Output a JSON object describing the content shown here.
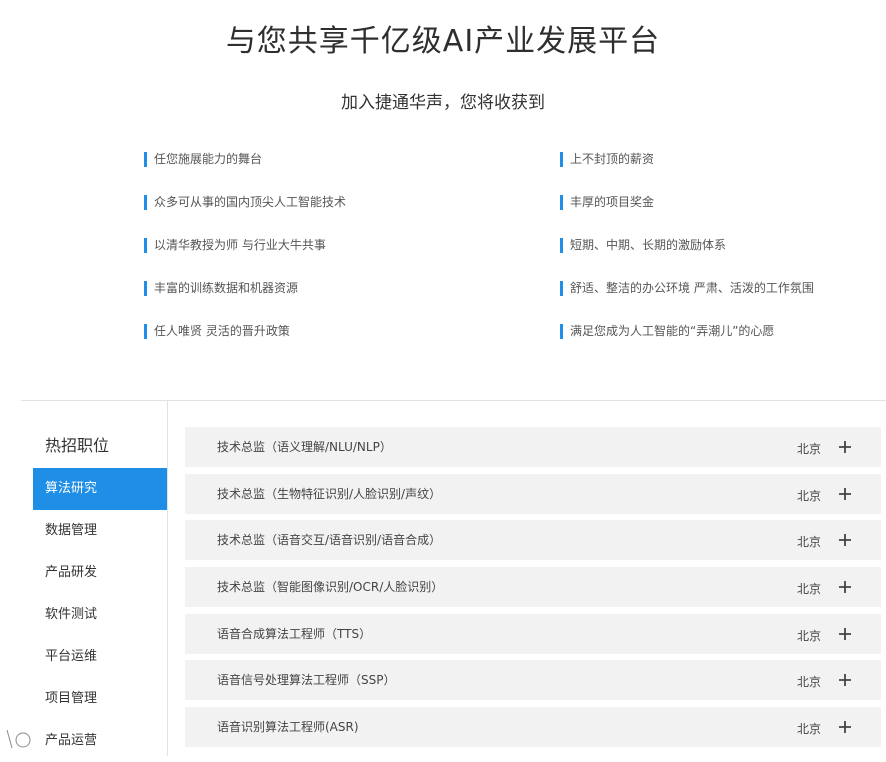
{
  "hero": {
    "title": "与您共享千亿级AI产业发展平台",
    "subtitle": "加入捷通华声，您将收获到"
  },
  "benefits": {
    "left": [
      "任您施展能力的舞台",
      "众多可从事的国内顶尖人工智能技术",
      "以清华教授为师  与行业大牛共事",
      "丰富的训练数据和机器资源",
      "任人唯贤  灵活的晋升政策"
    ],
    "right": [
      "上不封顶的薪资",
      "丰厚的项目奖金",
      "短期、中期、长期的激励体系",
      "舒适、整洁的办公环境  严肃、活泼的工作氛围",
      "满足您成为人工智能的“弄潮儿”的心愿"
    ]
  },
  "sidebar": {
    "heading": "热招职位",
    "items": [
      {
        "label": "算法研究",
        "active": true
      },
      {
        "label": "数据管理",
        "active": false
      },
      {
        "label": "产品研发",
        "active": false
      },
      {
        "label": "软件测试",
        "active": false
      },
      {
        "label": "平台运维",
        "active": false
      },
      {
        "label": "项目管理",
        "active": false
      },
      {
        "label": "产品运营",
        "active": false
      }
    ]
  },
  "jobs": [
    {
      "title": "技术总监（语义理解/NLU/NLP）",
      "city": "北京"
    },
    {
      "title": "技术总监（生物特征识别/人脸识别/声纹）",
      "city": "北京"
    },
    {
      "title": "技术总监（语音交互/语音识别/语音合成）",
      "city": "北京"
    },
    {
      "title": "技术总监（智能图像识别/OCR/人脸识别）",
      "city": "北京"
    },
    {
      "title": "语音合成算法工程师（TTS）",
      "city": "北京"
    },
    {
      "title": "语音信号处理算法工程师（SSP）",
      "city": "北京"
    },
    {
      "title": "语音识别算法工程师(ASR)",
      "city": "北京"
    }
  ],
  "icons": {
    "benefit_marker": "accent-bar",
    "expand": "plus-icon",
    "watermark": "watermark-logo-icon"
  },
  "colors": {
    "accent": "#1e8ee6",
    "row_background": "#f2f2f2"
  }
}
